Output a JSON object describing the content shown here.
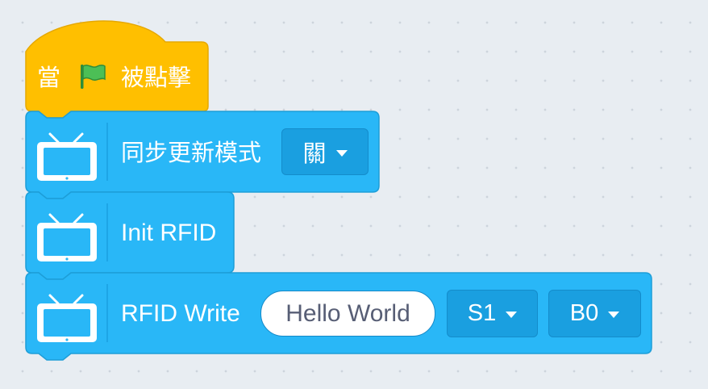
{
  "colors": {
    "event_block": "#ffbf00",
    "event_block_border": "#e6a800",
    "extension_block": "#29b7f7",
    "extension_block_border": "#1d9ed8",
    "dropdown_bg": "#1a9fe0",
    "flag_green": "#4cbf56"
  },
  "hat_block": {
    "label_when": "當",
    "flag_icon": "green-flag-icon",
    "label_clicked": "被點擊"
  },
  "block_sync": {
    "icon": "tv-icon",
    "label": "同步更新模式",
    "mode_value": "關"
  },
  "block_init": {
    "icon": "tv-icon",
    "label": "Init RFID"
  },
  "block_write": {
    "icon": "tv-icon",
    "label": "RFID Write",
    "text_value": "Hello World",
    "sector_value": "S1",
    "block_value": "B0"
  }
}
